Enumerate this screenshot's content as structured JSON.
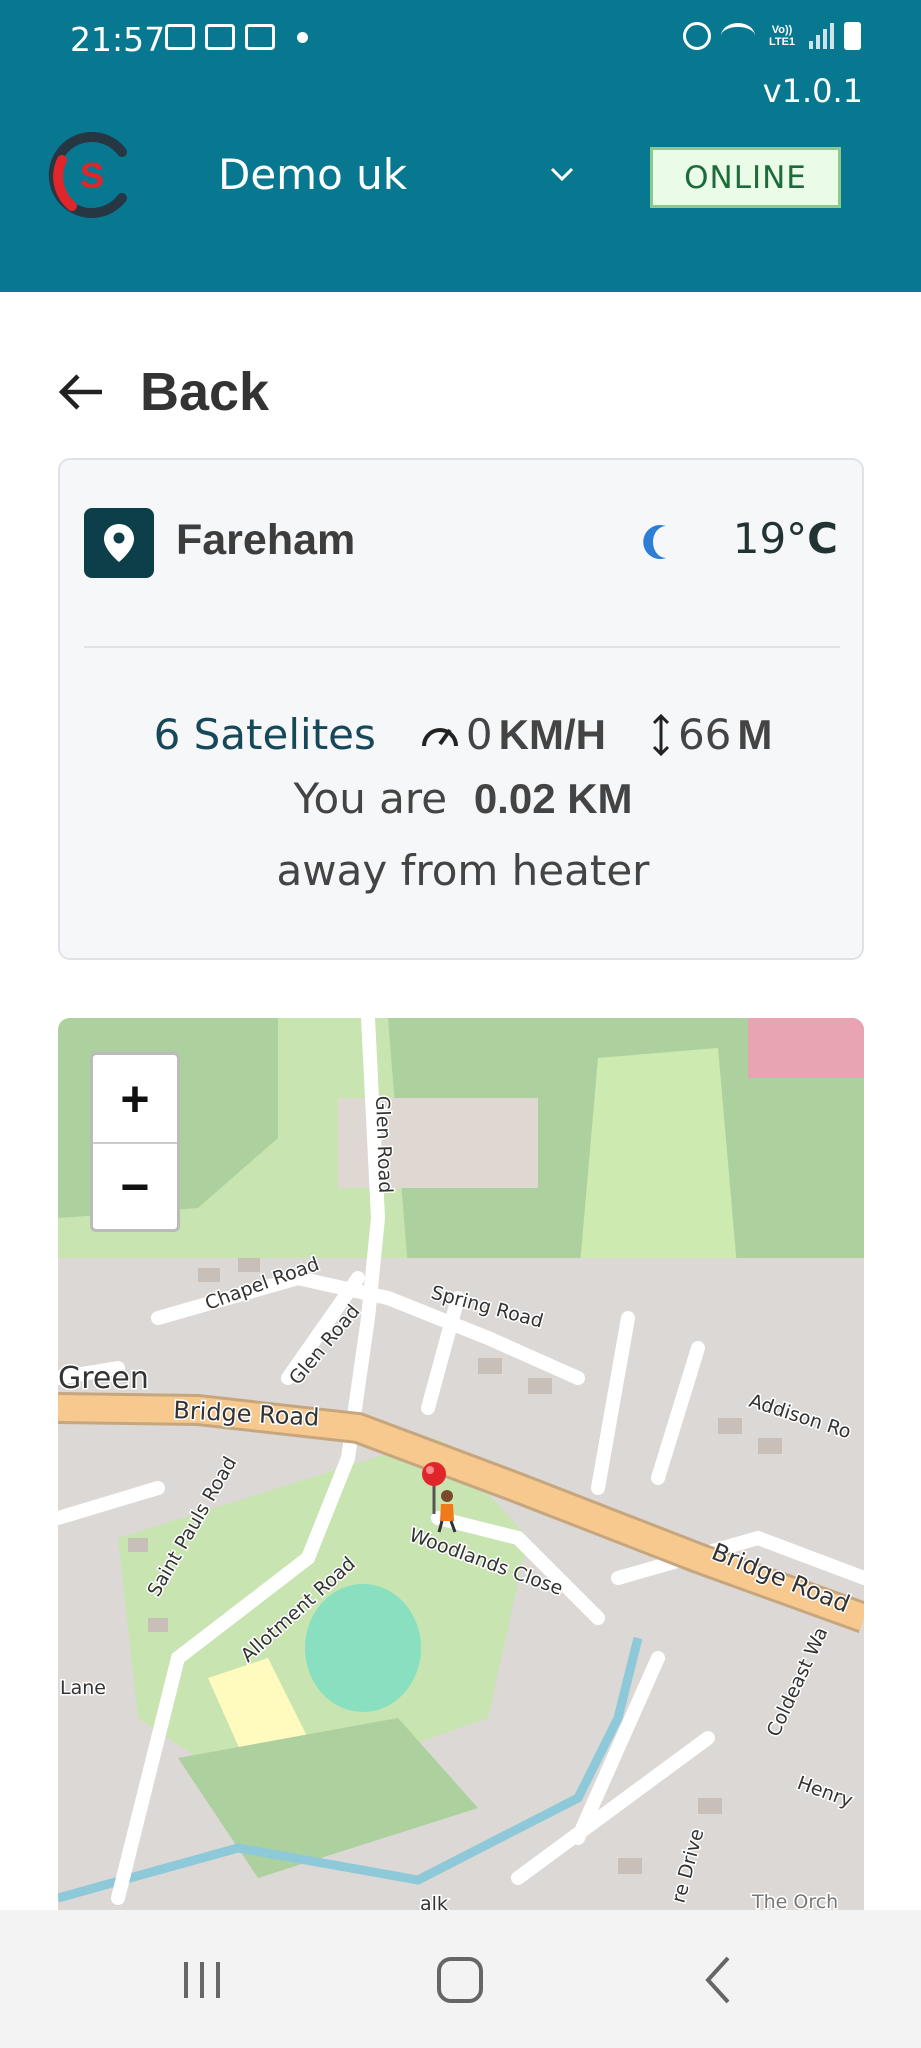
{
  "status_bar": {
    "time": "21:57",
    "network": "Vo)) LTE1"
  },
  "header": {
    "version": "v1.0.1",
    "account": "Demo uk",
    "status": "ONLINE",
    "colors": {
      "primary": "#07788f",
      "online_bg": "#eafbe7",
      "online_border": "#8bc98c"
    }
  },
  "back": {
    "label": "Back"
  },
  "info": {
    "location": "Fareham",
    "weather_icon": "moon-icon",
    "temperature_value": "19°",
    "temperature_unit": "C",
    "satellites": "6 Satelites",
    "speed_value": "0",
    "speed_unit": "KM/H",
    "altitude_value": "66",
    "altitude_unit": "M",
    "distance_prefix": "You are",
    "distance_value": "0.02 KM",
    "distance_suffix": "away from heater"
  },
  "map": {
    "zoom_in": "+",
    "zoom_out": "−",
    "labels": {
      "glen_road": "Glen Road",
      "chapel_road": "Chapel Road",
      "spring_road": "Spring Road",
      "glen_road_2": "Glen Road",
      "green": "Green",
      "bridge_road": "Bridge Road",
      "addison_road": "Addison Ro",
      "saint_pauls_road": "Saint Pauls Road",
      "woodlands_close": "Woodlands Close",
      "bridge_road_2": "Bridge Road",
      "allotment_road": "Allotment Road",
      "lane": "Lane",
      "coldeast_way": "Coldeast Wa",
      "henry": "Henry",
      "re_drive": "re Drive",
      "the_orch": "The Orch",
      "walk": "alk"
    }
  }
}
